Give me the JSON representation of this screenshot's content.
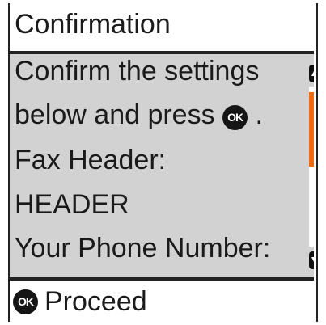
{
  "header": {
    "title": "Confirmation"
  },
  "body": {
    "line1": "Confirm the settings",
    "line2_before": "below and press",
    "line2_icon": "OK",
    "line2_after": ".",
    "line3": "Fax Header:",
    "line4": "HEADER",
    "line5": "Your Phone Number:"
  },
  "scrollbar": {
    "up_icon": "scroll-up-arrow-icon",
    "down_icon": "scroll-down-arrow-icon",
    "thumb_color": "#f26a10"
  },
  "footer": {
    "ok_icon": "OK",
    "proceed_label": "Proceed"
  },
  "colors": {
    "panel_bg": "#d2d2d2",
    "accent": "#f26a10",
    "text": "#1a1a1a"
  }
}
